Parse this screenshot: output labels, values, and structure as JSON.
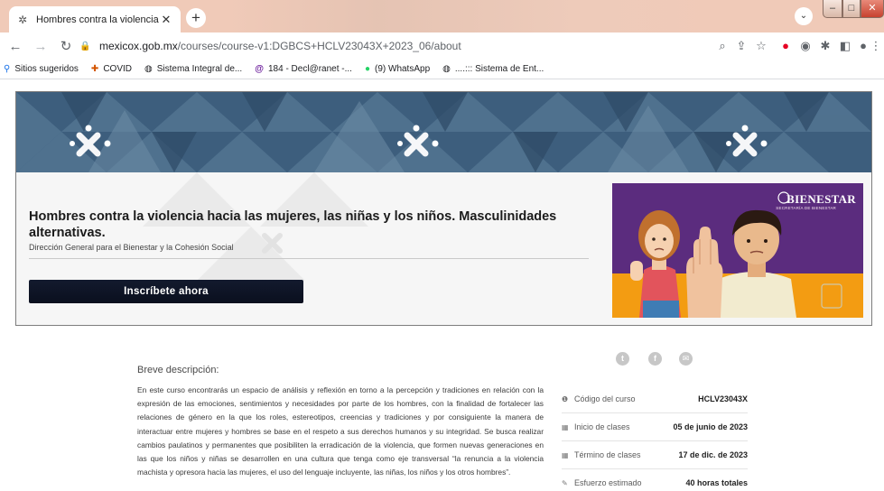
{
  "browser": {
    "tab_title": "Hombres contra la violencia haci",
    "url_host": "mexicox.gob.mx",
    "url_path": "/courses/course-v1:DGBCS+HCLV23043X+2023_06/about",
    "new_tab_label": "+",
    "bookmarks": [
      {
        "icon": "search-icon",
        "label": "Sitios sugeridos"
      },
      {
        "icon": "covid-icon",
        "label": "COVID"
      },
      {
        "icon": "globe-icon",
        "label": "Sistema Integral de..."
      },
      {
        "icon": "at-icon",
        "label": "184 - Decl@ranet -..."
      },
      {
        "icon": "whatsapp-icon",
        "label": "(9) WhatsApp"
      },
      {
        "icon": "globe-icon",
        "label": "....::: Sistema de Ent..."
      }
    ]
  },
  "course": {
    "title": "Hombres contra la violencia hacia las mujeres, las niñas y los niños. Masculinidades alternativas.",
    "org": "Dirección General para el Bienestar y la Cohesión Social",
    "enroll_label": "Inscríbete ahora",
    "promo_logo": "BIENESTAR",
    "promo_logo_sub": "SECRETARÍA DE BIENESTAR",
    "colors": {
      "banner": "#3d5e7d",
      "promo_purple": "#5b2c7e",
      "promo_orange": "#f39c12",
      "button": "#0f1526"
    }
  },
  "description": {
    "heading": "Breve descripción:",
    "text": "En este curso encontrarás un espacio de análisis y reflexión en torno a la percepción y tradiciones en relación con la expresión de las emociones, sentimientos y necesidades por parte de los hombres, con la finalidad de fortalecer las relaciones de género en la que los roles, estereotipos, creencias y tradiciones y por consiguiente la manera de interactuar entre mujeres y hombres se base en el respeto a sus derechos humanos y su integridad. Se busca realizar cambios paulatinos y permanentes que posibiliten la erradicación de la violencia, que formen nuevas generaciones en las que los niños y niñas se desarrollen en una cultura que tenga como eje transversal “la renuncia a la violencia machista y opresora hacia las mujeres, el uso del lenguaje incluyente, las niñas, los niños y los otros hombres”."
  },
  "details": [
    {
      "icon": "info-icon",
      "label": "Código del curso",
      "value": "HCLV23043X"
    },
    {
      "icon": "calendar-icon",
      "label": "Inicio de clases",
      "value": "05 de junio de 2023"
    },
    {
      "icon": "calendar-icon",
      "label": "Término de clases",
      "value": "17 de dic. de 2023"
    },
    {
      "icon": "pencil-icon",
      "label": "Esfuerzo estimado",
      "value": "40 horas totales"
    }
  ]
}
